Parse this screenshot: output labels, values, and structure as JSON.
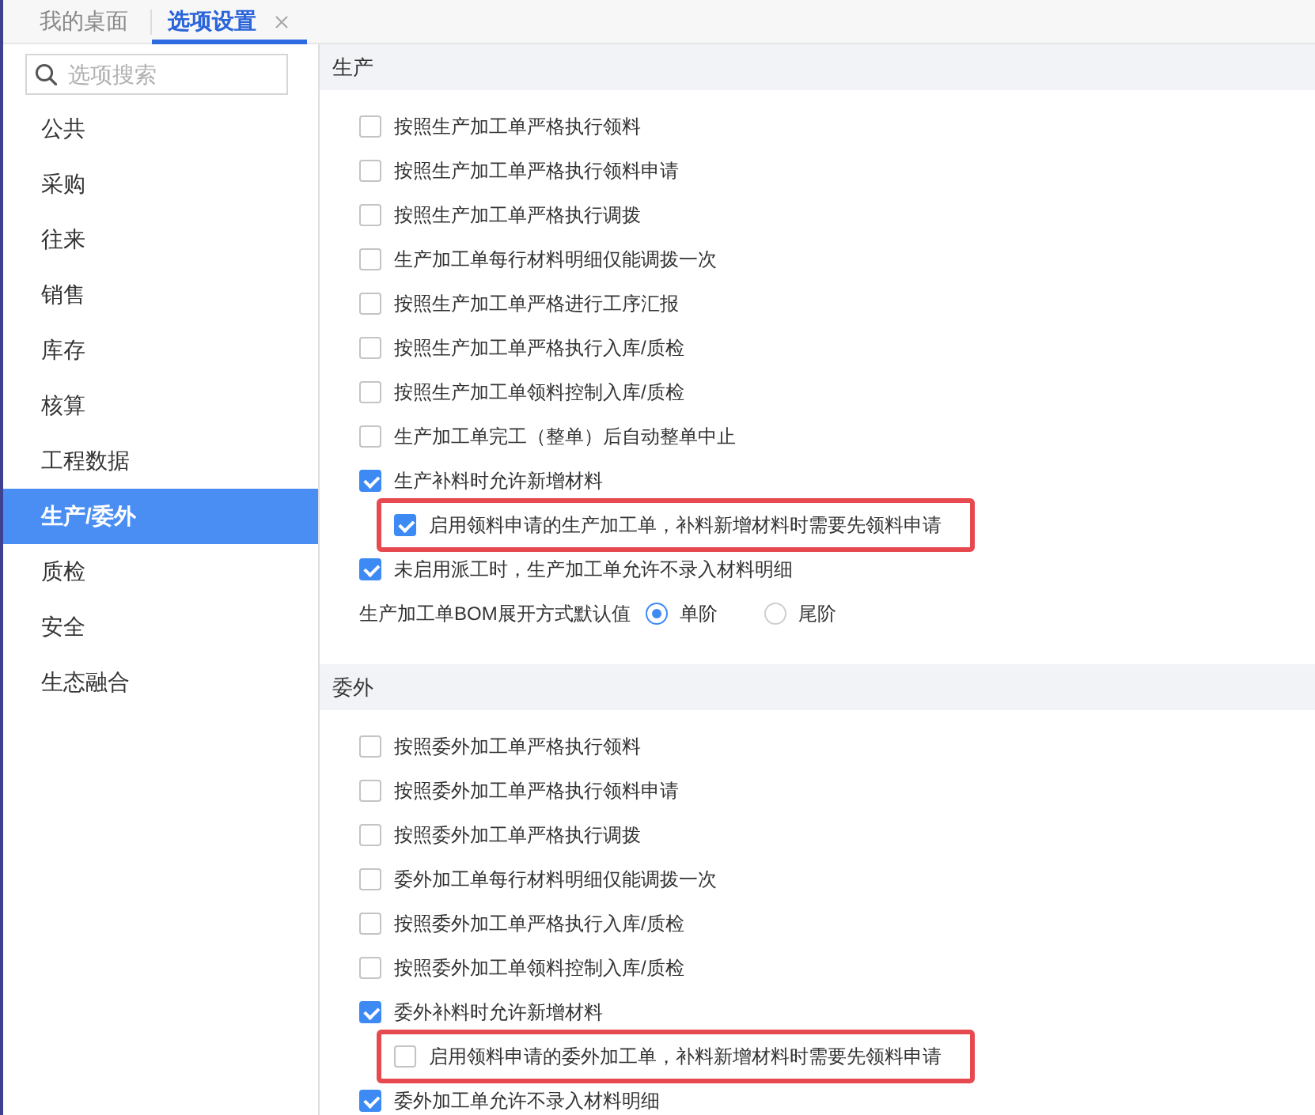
{
  "tabs": [
    {
      "label": "我的桌面",
      "selected": false,
      "closable": false
    },
    {
      "label": "选项设置",
      "selected": true,
      "closable": true
    }
  ],
  "sidebar": {
    "search": {
      "placeholder": "选项搜索"
    },
    "items": [
      {
        "label": "公共",
        "selected": false
      },
      {
        "label": "采购",
        "selected": false
      },
      {
        "label": "往来",
        "selected": false
      },
      {
        "label": "销售",
        "selected": false
      },
      {
        "label": "库存",
        "selected": false
      },
      {
        "label": "核算",
        "selected": false
      },
      {
        "label": "工程数据",
        "selected": false
      },
      {
        "label": "生产/委外",
        "selected": true
      },
      {
        "label": "质检",
        "selected": false
      },
      {
        "label": "安全",
        "selected": false
      },
      {
        "label": "生态融合",
        "selected": false
      }
    ]
  },
  "sections": [
    {
      "title": "生产",
      "options": [
        {
          "kind": "checkbox",
          "label": "按照生产加工单严格执行领料",
          "checked": false,
          "highlighted": false
        },
        {
          "kind": "checkbox",
          "label": "按照生产加工单严格执行领料申请",
          "checked": false,
          "highlighted": false
        },
        {
          "kind": "checkbox",
          "label": "按照生产加工单严格执行调拨",
          "checked": false,
          "highlighted": false
        },
        {
          "kind": "checkbox",
          "label": "生产加工单每行材料明细仅能调拨一次",
          "checked": false,
          "highlighted": false
        },
        {
          "kind": "checkbox",
          "label": "按照生产加工单严格进行工序汇报",
          "checked": false,
          "highlighted": false
        },
        {
          "kind": "checkbox",
          "label": "按照生产加工单严格执行入库/质检",
          "checked": false,
          "highlighted": false
        },
        {
          "kind": "checkbox",
          "label": "按照生产加工单领料控制入库/质检",
          "checked": false,
          "highlighted": false
        },
        {
          "kind": "checkbox",
          "label": "生产加工单完工（整单）后自动整单中止",
          "checked": false,
          "highlighted": false
        },
        {
          "kind": "checkbox",
          "label": "生产补料时允许新增材料",
          "checked": true,
          "highlighted": false,
          "children": [
            {
              "kind": "checkbox",
              "label": "启用领料申请的生产加工单，补料新增材料时需要先领料申请",
              "checked": true,
              "highlighted": true
            }
          ]
        },
        {
          "kind": "checkbox",
          "label": "未启用派工时，生产加工单允许不录入材料明细",
          "checked": true,
          "highlighted": false
        },
        {
          "kind": "radio",
          "label": "生产加工单BOM展开方式默认值",
          "choices": [
            {
              "label": "单阶",
              "selected": true
            },
            {
              "label": "尾阶",
              "selected": false
            }
          ]
        }
      ]
    },
    {
      "title": "委外",
      "options": [
        {
          "kind": "checkbox",
          "label": "按照委外加工单严格执行领料",
          "checked": false,
          "highlighted": false
        },
        {
          "kind": "checkbox",
          "label": "按照委外加工单严格执行领料申请",
          "checked": false,
          "highlighted": false
        },
        {
          "kind": "checkbox",
          "label": "按照委外加工单严格执行调拨",
          "checked": false,
          "highlighted": false
        },
        {
          "kind": "checkbox",
          "label": "委外加工单每行材料明细仅能调拨一次",
          "checked": false,
          "highlighted": false
        },
        {
          "kind": "checkbox",
          "label": "按照委外加工单严格执行入库/质检",
          "checked": false,
          "highlighted": false
        },
        {
          "kind": "checkbox",
          "label": "按照委外加工单领料控制入库/质检",
          "checked": false,
          "highlighted": false
        },
        {
          "kind": "checkbox",
          "label": "委外补料时允许新增材料",
          "checked": true,
          "highlighted": false,
          "children": [
            {
              "kind": "checkbox",
              "label": "启用领料申请的委外加工单，补料新增材料时需要先领料申请",
              "checked": false,
              "highlighted": true
            }
          ]
        },
        {
          "kind": "checkbox",
          "label": "委外加工单允许不录入材料明细",
          "checked": true,
          "highlighted": false
        }
      ]
    }
  ]
}
